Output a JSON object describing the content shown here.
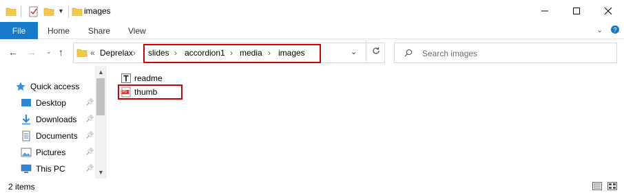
{
  "window": {
    "title": "images",
    "qat_icons": [
      "folder-icon",
      "properties-icon",
      "new-folder-icon",
      "customize-qat-icon"
    ],
    "controls": [
      "minimize-icon",
      "maximize-icon",
      "close-icon"
    ]
  },
  "ribbon": {
    "tabs": [
      "File",
      "Home",
      "Share",
      "View"
    ],
    "right_icons": [
      "expand-ribbon-icon",
      "help-icon"
    ]
  },
  "address": {
    "root_marker": "«",
    "segments": [
      "Deprelax",
      "slides",
      "accordion1",
      "media",
      "images"
    ],
    "separator": "›"
  },
  "search": {
    "placeholder": "Search images"
  },
  "nav_pane": {
    "items": [
      {
        "label": "Quick access",
        "icon": "star-icon"
      },
      {
        "label": "Desktop",
        "icon": "desktop-icon",
        "pinned": true
      },
      {
        "label": "Downloads",
        "icon": "download-icon",
        "pinned": true
      },
      {
        "label": "Documents",
        "icon": "documents-icon",
        "pinned": true
      },
      {
        "label": "Pictures",
        "icon": "pictures-icon",
        "pinned": true
      },
      {
        "label": "This PC",
        "icon": "computer-icon",
        "pinned": true
      }
    ]
  },
  "files": [
    {
      "name": "readme",
      "icon": "text-file-icon"
    },
    {
      "name": "thumb",
      "icon": "jpg-file-icon",
      "icon_label": "JPG"
    }
  ],
  "status": {
    "count": "2 items"
  },
  "colors": {
    "file_tab": "#1979ca",
    "highlight_box": "#d00000",
    "folder": "#f4c842"
  }
}
